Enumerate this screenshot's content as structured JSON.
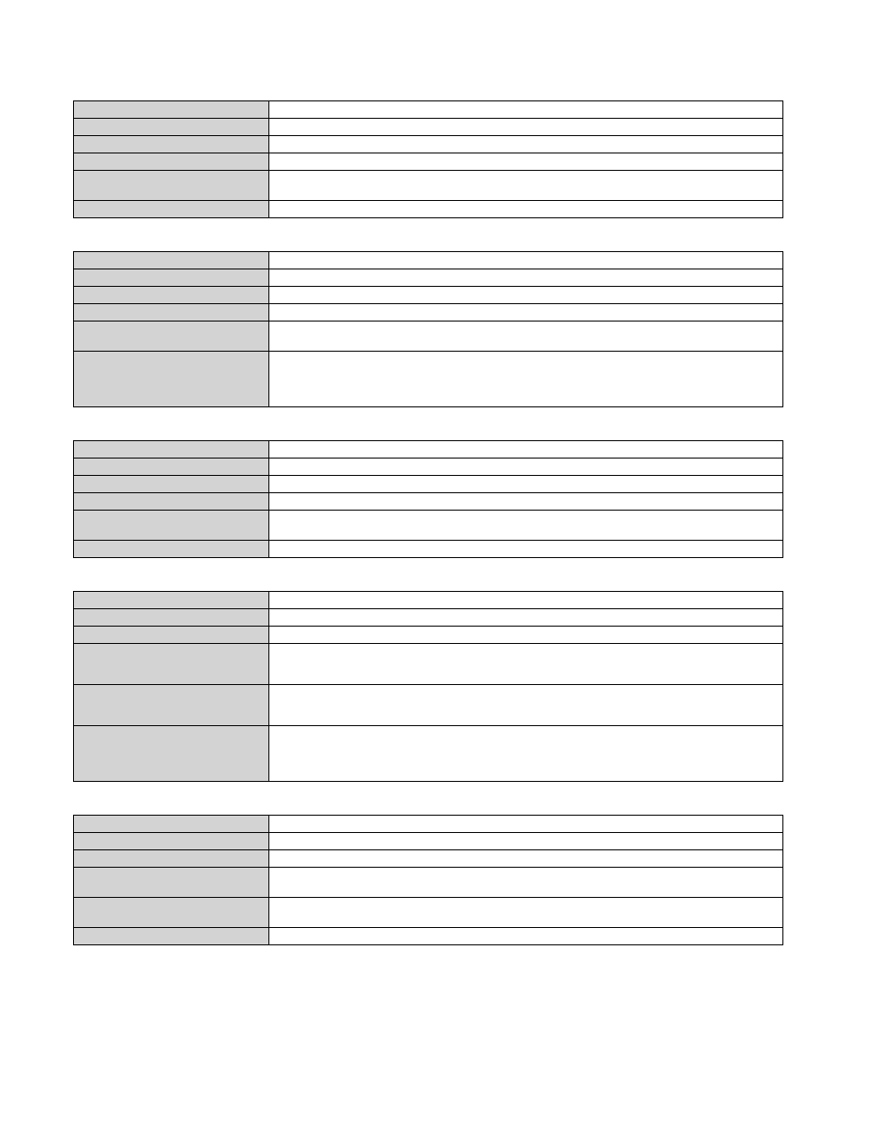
{
  "tables": [
    {
      "rows": [
        {
          "label": "",
          "value": "",
          "height": "h-short"
        },
        {
          "label": "",
          "value": "",
          "height": "h-short"
        },
        {
          "label": "",
          "value": "",
          "height": "h-short"
        },
        {
          "label": "",
          "value": "",
          "height": "h-short"
        },
        {
          "label": "",
          "value": "",
          "height": "h-tall"
        },
        {
          "label": "",
          "value": "",
          "height": "h-short"
        }
      ]
    },
    {
      "rows": [
        {
          "label": "",
          "value": "",
          "height": "h-short"
        },
        {
          "label": "",
          "value": "",
          "height": "h-short"
        },
        {
          "label": "",
          "value": "",
          "height": "h-short"
        },
        {
          "label": "",
          "value": "",
          "height": "h-short"
        },
        {
          "label": "",
          "value": "",
          "height": "h-tall"
        },
        {
          "label": "",
          "value": "",
          "height": "h-xxtall"
        }
      ]
    },
    {
      "rows": [
        {
          "label": "",
          "value": "",
          "height": "h-short"
        },
        {
          "label": "",
          "value": "",
          "height": "h-short"
        },
        {
          "label": "",
          "value": "",
          "height": "h-short"
        },
        {
          "label": "",
          "value": "",
          "height": "h-short"
        },
        {
          "label": "",
          "value": "",
          "height": "h-tall"
        },
        {
          "label": "",
          "value": "",
          "height": "h-short"
        }
      ]
    },
    {
      "rows": [
        {
          "label": "",
          "value": "",
          "height": "h-short"
        },
        {
          "label": "",
          "value": "",
          "height": "h-short"
        },
        {
          "label": "",
          "value": "",
          "height": "h-short"
        },
        {
          "label": "",
          "value": "",
          "height": "h-xtall"
        },
        {
          "label": "",
          "value": "",
          "height": "h-xtall"
        },
        {
          "label": "",
          "value": "",
          "height": "h-xxtall"
        }
      ]
    },
    {
      "rows": [
        {
          "label": "",
          "value": "",
          "height": "h-short"
        },
        {
          "label": "",
          "value": "",
          "height": "h-short"
        },
        {
          "label": "",
          "value": "",
          "height": "h-short"
        },
        {
          "label": "",
          "value": "",
          "height": "h-tall"
        },
        {
          "label": "",
          "value": "",
          "height": "h-tall"
        },
        {
          "label": "",
          "value": "",
          "height": "h-short"
        }
      ]
    }
  ]
}
